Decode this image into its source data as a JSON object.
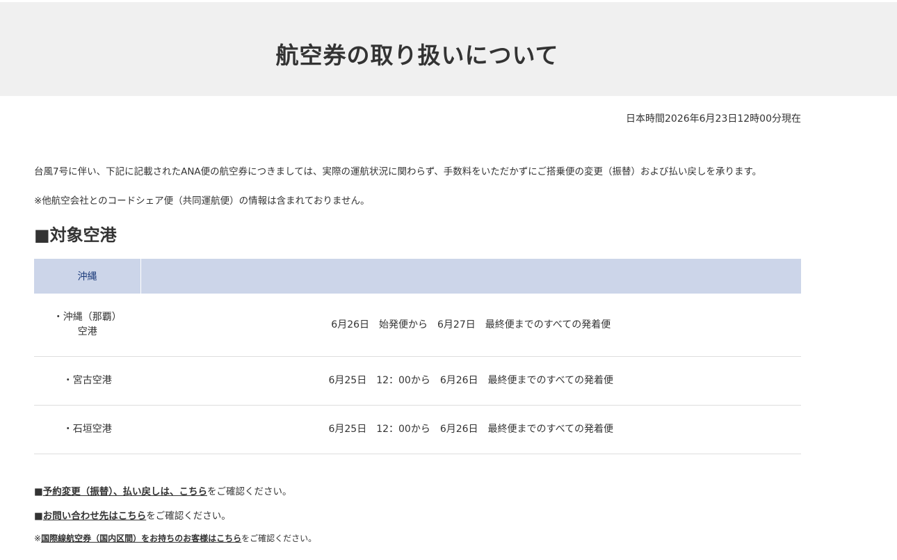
{
  "header": {
    "title": "航空券の取り扱いについて"
  },
  "timestamp": "日本時間2026年6月23日12時00分現在",
  "intro": "台風7号に伴い、下記に記載されたANA便の航空券につきましては、実際の運航状況に関わらず、手数料をいただかずにご搭乗便の変更（振替）および払い戻しを承ります。",
  "note": "※他航空会社とのコードシェア便（共同運航便）の情報は含まれておりません。",
  "section": {
    "title": "■対象空港"
  },
  "table": {
    "region": "沖縄",
    "rows": [
      {
        "airport_line1": "・沖縄（那覇）",
        "airport_line2": "空港",
        "period": "6月26日　始発便から　6月27日　最終便までのすべての発着便"
      },
      {
        "airport_line1": "・宮古空港",
        "airport_line2": "",
        "period": "6月25日　12：00から　6月26日　最終便までのすべての発着便"
      },
      {
        "airport_line1": "・石垣空港",
        "airport_line2": "",
        "period": "6月25日　12：00から　6月26日　最終便までのすべての発着便"
      }
    ]
  },
  "links": {
    "change_prefix": "■",
    "change_link": "予約変更（振替）、払い戻しは、こちら",
    "change_suffix": "をご確認ください。",
    "contact_prefix": "■",
    "contact_link": "お問い合わせ先はこちら",
    "contact_suffix": "をご確認ください。",
    "intl_prefix": "※",
    "intl_link": "国際線航空券（国内区間）をお持ちのお客様はこちら",
    "intl_suffix": "をご確認ください。"
  }
}
